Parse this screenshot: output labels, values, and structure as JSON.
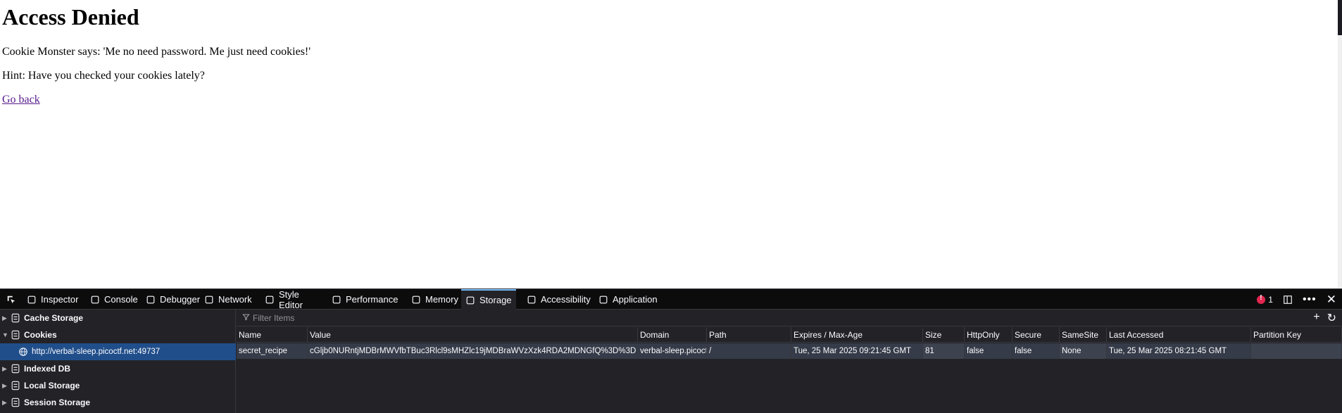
{
  "page": {
    "heading": "Access Denied",
    "line1": "Cookie Monster says: 'Me no need password. Me just need cookies!'",
    "line2": "Hint: Have you checked your cookies lately?",
    "link": "Go back"
  },
  "devtools": {
    "tabs": [
      {
        "label": "Inspector",
        "icon": "inspector-icon"
      },
      {
        "label": "Console",
        "icon": "console-icon"
      },
      {
        "label": "Debugger",
        "icon": "debugger-icon"
      },
      {
        "label": "Network",
        "icon": "network-icon"
      },
      {
        "label": "Style Editor",
        "icon": "style-editor-icon"
      },
      {
        "label": "Performance",
        "icon": "performance-icon"
      },
      {
        "label": "Memory",
        "icon": "memory-icon"
      },
      {
        "label": "Storage",
        "icon": "storage-icon",
        "active": true
      },
      {
        "label": "Accessibility",
        "icon": "accessibility-icon"
      },
      {
        "label": "Application",
        "icon": "application-icon"
      }
    ],
    "error_count": "1",
    "sidebar": {
      "items": [
        {
          "label": "Cache Storage",
          "expanded": false
        },
        {
          "label": "Cookies",
          "expanded": true
        },
        {
          "label": "http://verbal-sleep.picoctf.net:49737",
          "child": true,
          "selected": true
        },
        {
          "label": "Indexed DB",
          "expanded": false
        },
        {
          "label": "Local Storage",
          "expanded": false
        },
        {
          "label": "Session Storage",
          "expanded": false
        }
      ]
    },
    "filter": {
      "placeholder": "Filter Items"
    },
    "table": {
      "columns": [
        "Name",
        "Value",
        "Domain",
        "Path",
        "Expires / Max-Age",
        "Size",
        "HttpOnly",
        "Secure",
        "SameSite",
        "Last Accessed",
        "Partition Key"
      ],
      "rows": [
        {
          "Name": "secret_recipe",
          "Value": "cGljb0NURntjMDBrMWVfbTBuc3Rlcl9sMHZlc19jMDBraWVzXzk4RDA2MDNGfQ%3D%3D",
          "Domain": "verbal-sleep.picoctf.net",
          "Path": "/",
          "Expires / Max-Age": "Tue, 25 Mar 2025 09:21:45 GMT",
          "Size": "81",
          "HttpOnly": "false",
          "Secure": "false",
          "SameSite": "None",
          "Last Accessed": "Tue, 25 Mar 2025 08:21:45 GMT",
          "Partition Key": ""
        }
      ]
    }
  }
}
